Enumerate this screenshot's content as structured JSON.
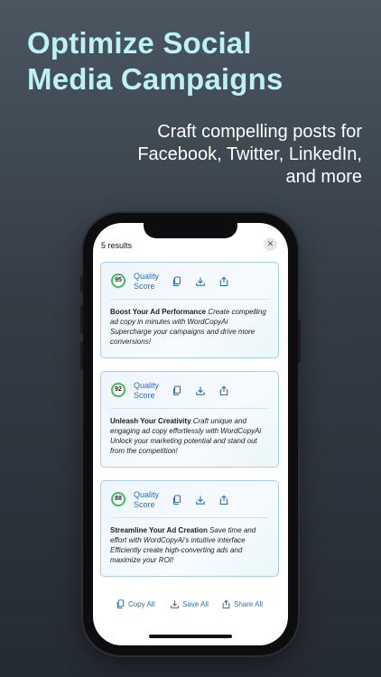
{
  "promo": {
    "headline_line1": "Optimize Social",
    "headline_line2": "Media Campaigns",
    "sub_line1": "Craft compelling posts for",
    "sub_line2": "Facebook, Twitter, LinkedIn,",
    "sub_line3": "and more"
  },
  "results": {
    "count_label": "5 results",
    "close_glyph": "✕"
  },
  "cards": [
    {
      "score": "95",
      "score_label_1": "Quality",
      "score_label_2": "Score",
      "title": "Boost Your Ad Performance",
      "body": " Create compelling ad copy in minutes with WordCopyAi Supercharge your campaigns and drive more conversions!"
    },
    {
      "score": "92",
      "score_label_1": "Quality",
      "score_label_2": "Score",
      "title": "Unleash Your Creativity",
      "body": " Craft unique and engaging ad copy effortlessly with WordCopyAi Unlock your marketing potential and stand out from the competition!"
    },
    {
      "score": "88",
      "score_label_1": "Quality",
      "score_label_2": "Score",
      "title": "Streamline Your Ad Creation",
      "body": " Save time and effort with WordCopyAi's intuitive interface Efficiently create high-converting ads and maximize your ROI!"
    }
  ],
  "footer": {
    "copy_all": "Copy All",
    "save_all": "Save All",
    "share_all": "Share All"
  },
  "colors": {
    "accent_blue": "#2f6fb5",
    "score_green": "#3fbf57",
    "headline": "#bdf1f6"
  },
  "icons": {
    "copy": "copy-icon",
    "save": "download-icon",
    "share": "share-icon",
    "close": "close-icon"
  }
}
